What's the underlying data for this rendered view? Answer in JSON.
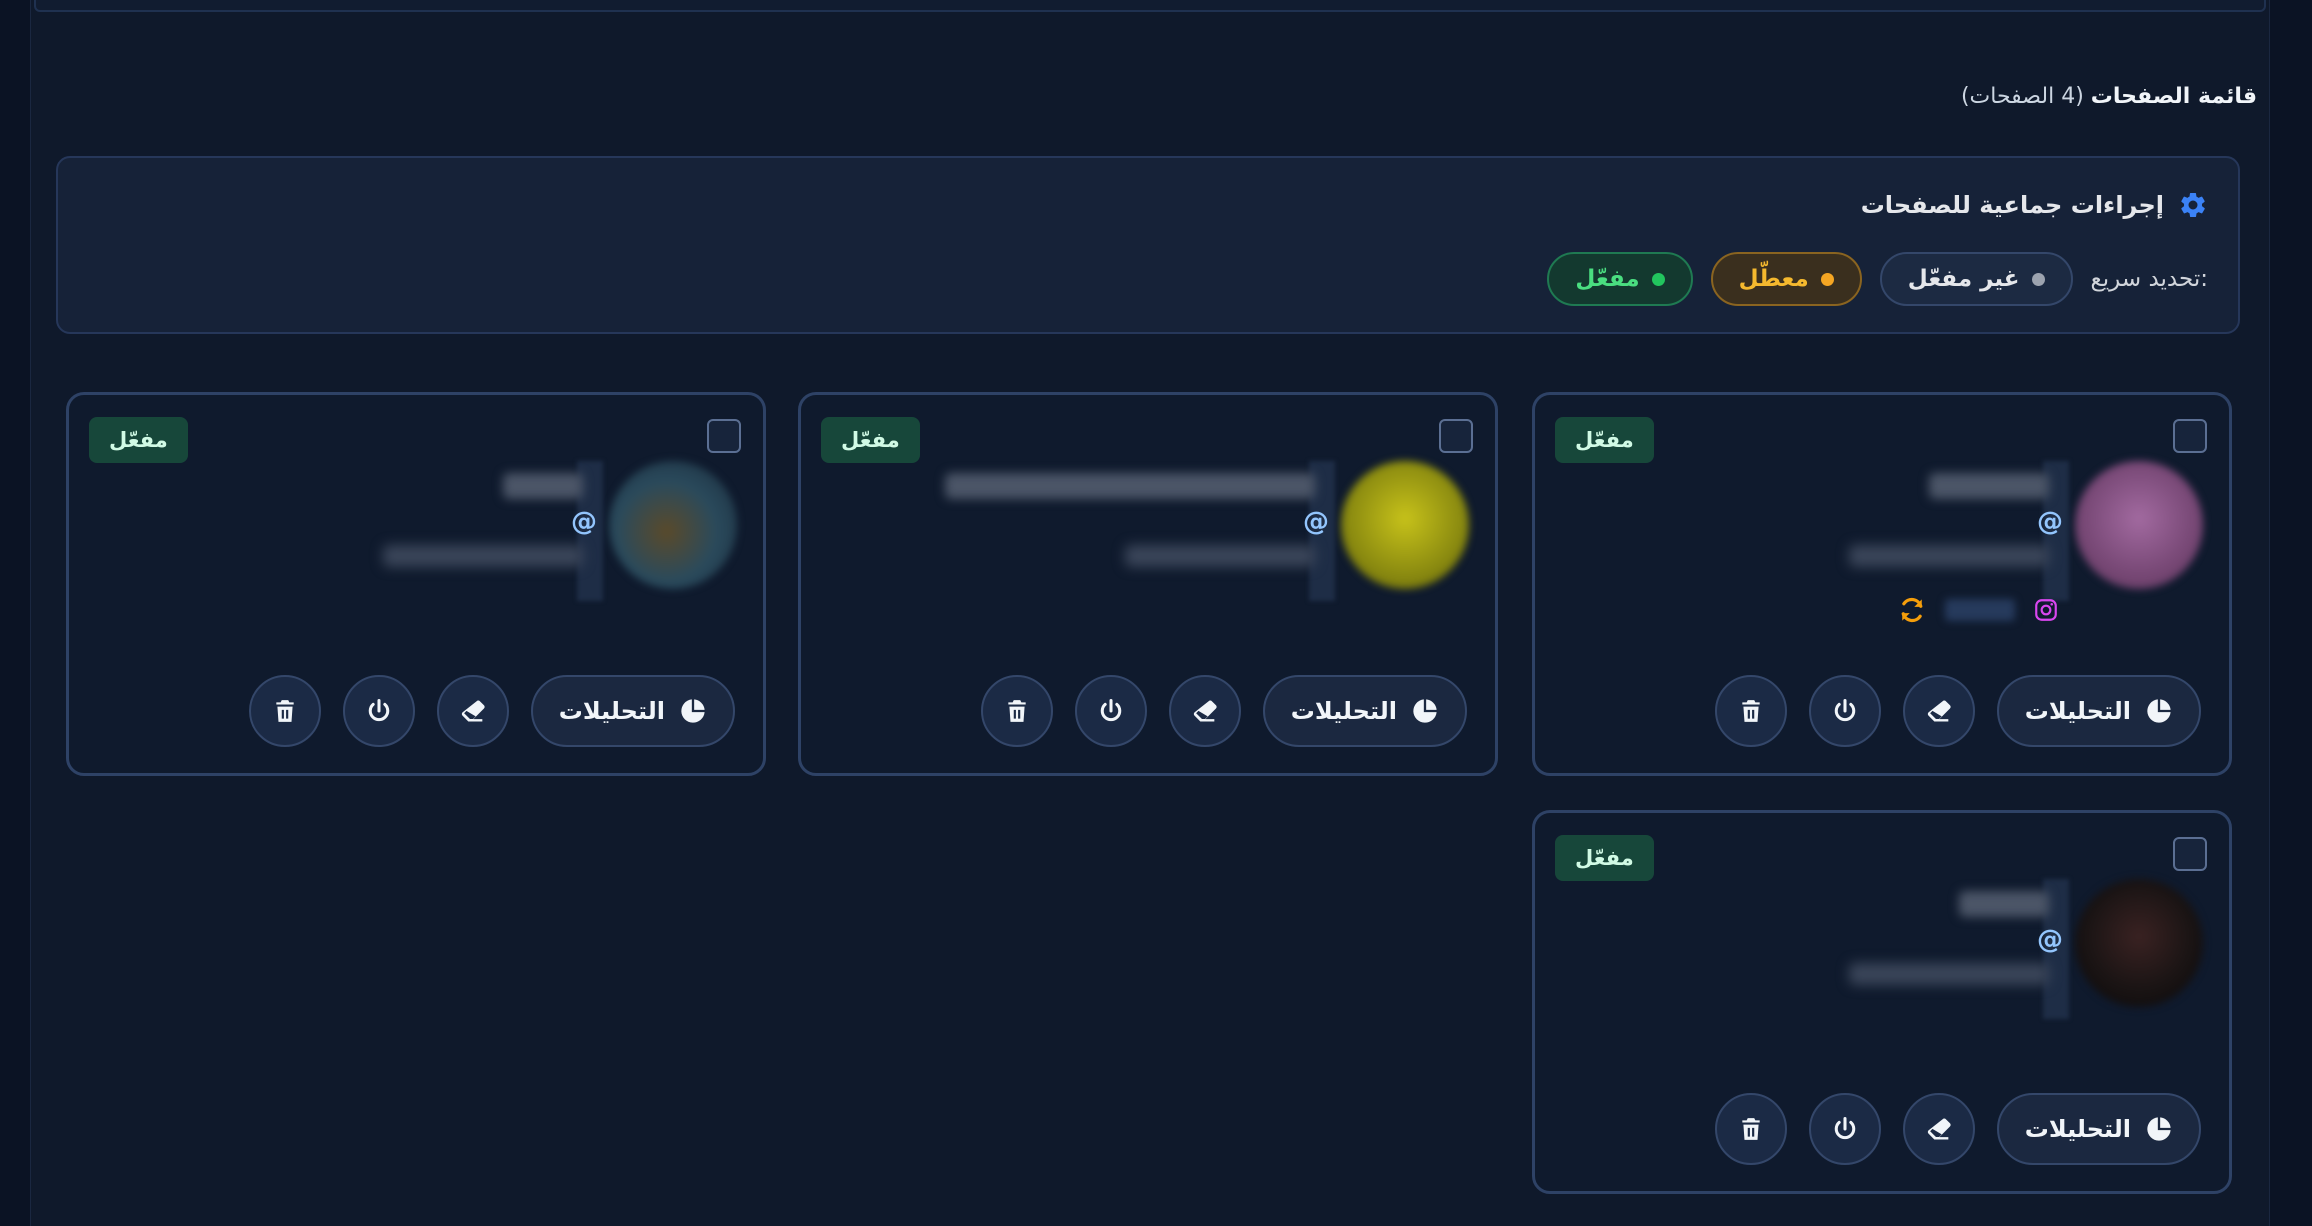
{
  "section": {
    "title": "قائمة الصفحات",
    "count": "(4 الصفحات)"
  },
  "bulk": {
    "title": "إجراءات جماعية للصفحات",
    "icon": "gear-icon",
    "quick_label": "تحديد سريع:",
    "pills": {
      "inactive": "غير مفعّل",
      "disabled": "معطّل",
      "enabled": "مفعّل"
    }
  },
  "cards": [
    {
      "badge": "مفعّل",
      "at": "@",
      "analytics": "التحليلات",
      "avatar_color": "#7a4a78",
      "has_instagram": true
    },
    {
      "badge": "مفعّل",
      "at": "@",
      "analytics": "التحليلات",
      "avatar_color": "#8a8a10",
      "has_instagram": false
    },
    {
      "badge": "مفعّل",
      "at": "@",
      "analytics": "التحليلات",
      "avatar_color": "#2a4a5c",
      "has_instagram": false
    },
    {
      "badge": "مفعّل",
      "at": "@",
      "analytics": "التحليلات",
      "avatar_color": "#1a1414",
      "has_instagram": false
    }
  ],
  "colors": {
    "accent": "#3b82f6",
    "enabled": "#22c55e",
    "disabled": "#f5a623",
    "sync": "#f59e0b",
    "instagram": "#d946ef"
  }
}
